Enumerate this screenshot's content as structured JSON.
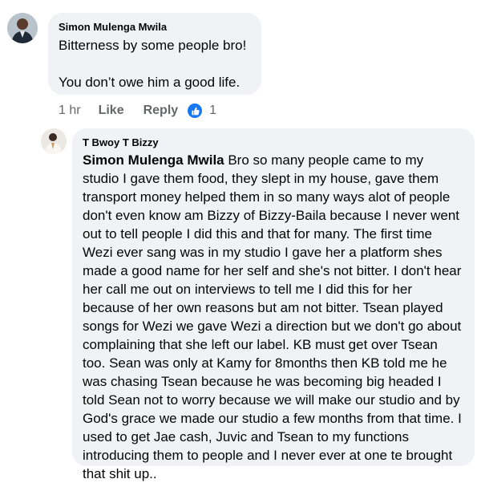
{
  "comment": {
    "author": "Simon Mulenga Mwila",
    "lines": [
      "Bitterness by some people bro!",
      "You don’t owe him a good life."
    ],
    "time": "1 hr",
    "like_label": "Like",
    "reply_label": "Reply",
    "reaction_icon": "like-thumb-icon",
    "reaction_count": "1",
    "accent_color": "#1877f2"
  },
  "reply": {
    "author": "T Bwoy T Bizzy",
    "mention": "Simon Mulenga Mwila",
    "text": " Bro so many people came to my studio I gave them food, they slept in my house, gave them transport money helped them in so many ways alot of people don't even know am Bizzy of Bizzy-Baila because I never went out to tell people I did this and that for many. The first time Wezi ever sang was in my studio I gave her a platform shes made a good name for her self and she's not bitter. I don't hear her call me out on interviews to tell me I did this for her because of her own reasons but am not bitter. Tsean played songs for Wezi we gave Wezi a direction but we don't go about complaining that she left our label. KB must get over Tsean too. Sean was only at Kamy for 8months then KB told me he was chasing Tsean because he was becoming big headed I told Sean not to worry because we will make our studio and by God's grace we made our studio a few months from that time. I used to get Jae cash, Juvic and Tsean to my functions introducing them to people and I never ever at one te brought that shit up.."
  }
}
